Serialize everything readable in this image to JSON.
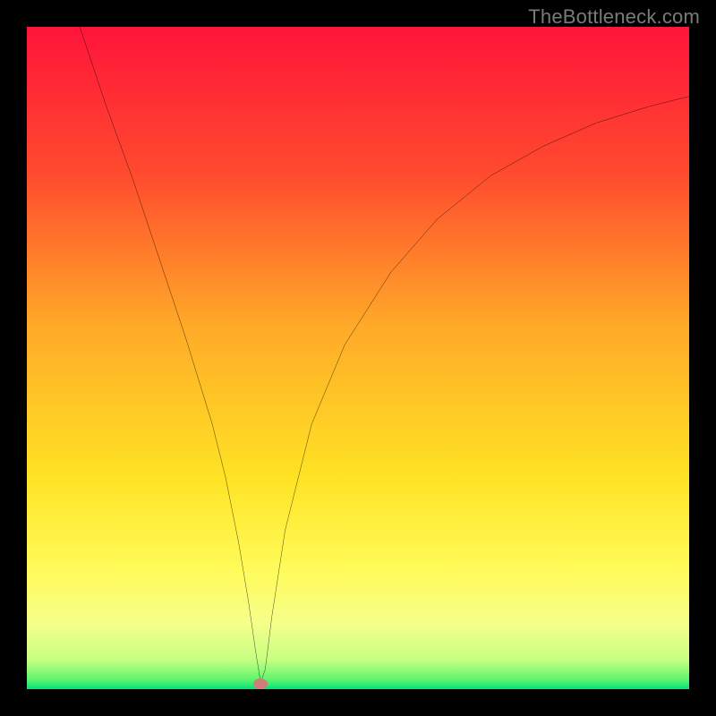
{
  "watermark": "TheBottleneck.com",
  "chart_data": {
    "type": "line",
    "title": "",
    "xlabel": "",
    "ylabel": "",
    "xlim": [
      0,
      100
    ],
    "ylim": [
      0,
      100
    ],
    "grid": false,
    "legend": false,
    "background_gradient_stops": [
      {
        "offset": 0.0,
        "color": "#ff143a"
      },
      {
        "offset": 0.22,
        "color": "#ff4a2e"
      },
      {
        "offset": 0.45,
        "color": "#ffa928"
      },
      {
        "offset": 0.68,
        "color": "#ffe324"
      },
      {
        "offset": 0.82,
        "color": "#fffb5a"
      },
      {
        "offset": 0.9,
        "color": "#f6ff8a"
      },
      {
        "offset": 0.955,
        "color": "#c8ff82"
      },
      {
        "offset": 0.985,
        "color": "#62f56e"
      },
      {
        "offset": 1.0,
        "color": "#02e27a"
      }
    ],
    "series": [
      {
        "name": "bottleneck-curve",
        "color": "#000000",
        "x": [
          8,
          12,
          16,
          20,
          24,
          28,
          30,
          32,
          33.5,
          34.5,
          35.3,
          36,
          37,
          39,
          43,
          48,
          55,
          62,
          70,
          78,
          86,
          94,
          100
        ],
        "y": [
          100,
          88,
          77,
          65,
          53,
          40,
          32,
          22,
          13,
          6,
          1,
          3,
          11,
          24,
          40,
          52,
          63,
          71,
          77.5,
          82,
          85.5,
          88,
          89.5
        ]
      }
    ],
    "marker": {
      "name": "minimum-point",
      "x": 35.3,
      "y": 0.8,
      "color": "#cf7d79"
    }
  }
}
